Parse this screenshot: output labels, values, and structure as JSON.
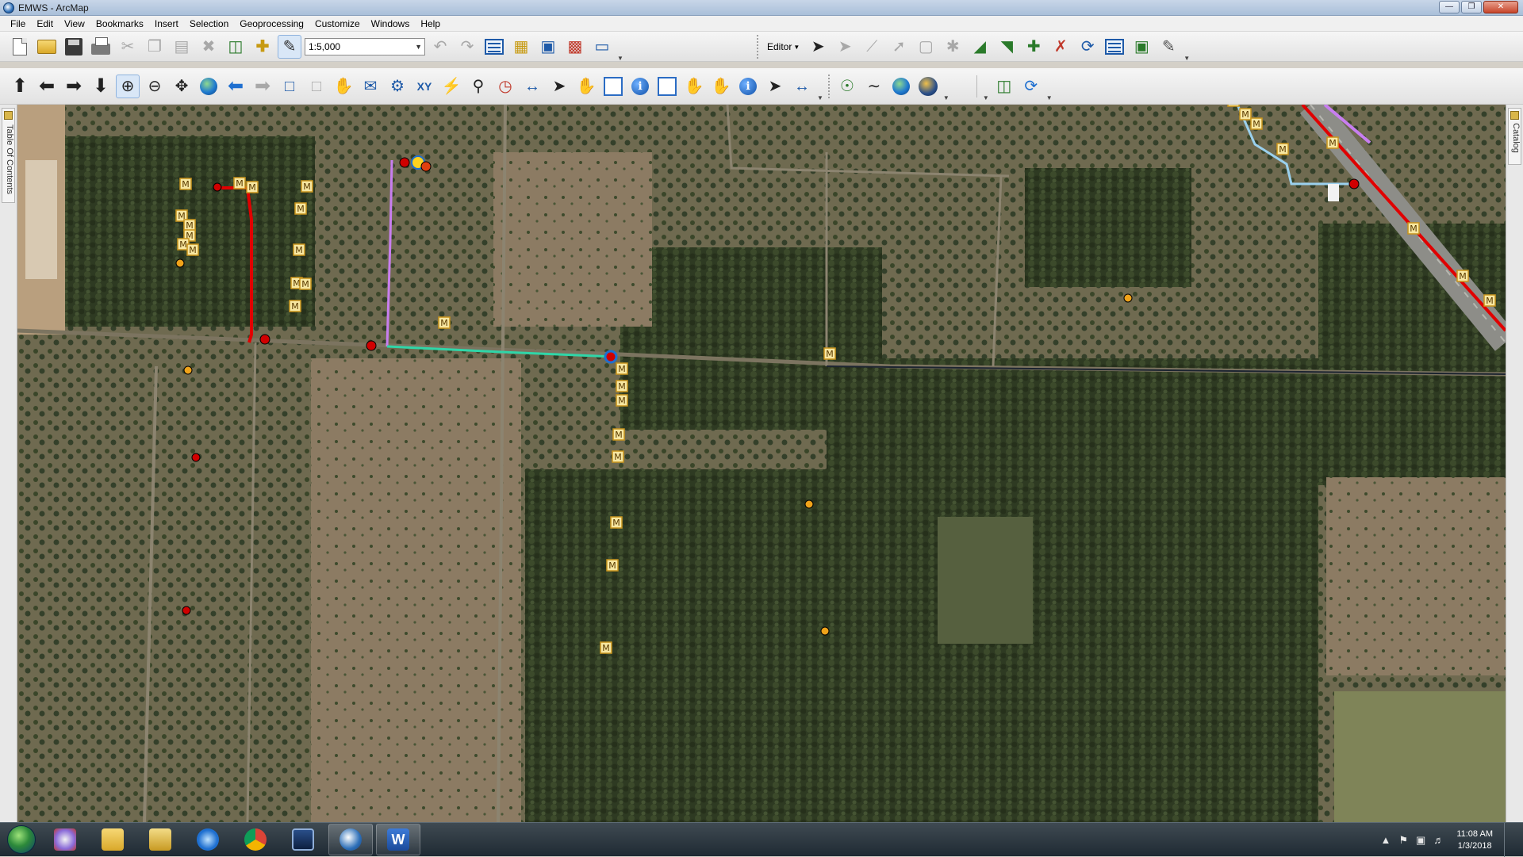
{
  "window": {
    "title": "EMWS - ArcMap"
  },
  "menu": [
    "File",
    "Edit",
    "View",
    "Bookmarks",
    "Insert",
    "Selection",
    "Geoprocessing",
    "Customize",
    "Windows",
    "Help"
  ],
  "toolbar": {
    "map_scale": "1:5,000",
    "editor_label": "Editor"
  },
  "docks": {
    "left_tab": "Table Of Contents",
    "right_tab": "Catalog"
  },
  "map": {
    "marker_label": "M",
    "colors": {
      "red_line": "#e00000",
      "purple_line": "#c87ef0",
      "teal_line": "#2fd6a8",
      "light_blue_line": "#9ad0ee",
      "marker_fill": "#f7e7a1",
      "marker_stroke": "#c8941c"
    }
  },
  "taskbar": {
    "apps": [
      "windows-explorer",
      "file-explorer",
      "internet-explorer",
      "chrome",
      "remote-desktop",
      "arcmap",
      "word"
    ],
    "clock_time": "11:08 AM",
    "clock_date": "1/3/2018"
  }
}
